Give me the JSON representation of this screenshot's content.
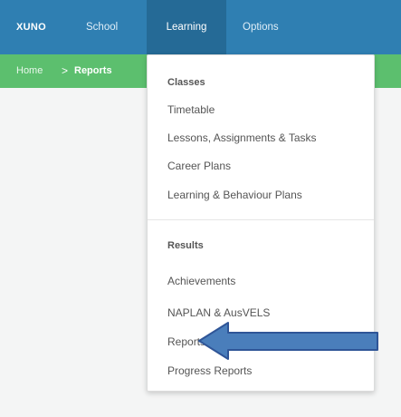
{
  "navbar": {
    "brand": "XUNO",
    "items": [
      {
        "label": "School"
      },
      {
        "label": "Learning"
      },
      {
        "label": "Options"
      }
    ]
  },
  "breadcrumb": {
    "home": "Home",
    "separator": ">",
    "current": "Reports"
  },
  "dropdown": {
    "sections": [
      {
        "header": "Classes",
        "items": [
          {
            "label": "Timetable"
          },
          {
            "label": "Lessons, Assignments & Tasks"
          },
          {
            "label": "Career Plans"
          },
          {
            "label": "Learning & Behaviour Plans"
          }
        ]
      },
      {
        "header": "Results",
        "items": [
          {
            "label": "Achievements"
          },
          {
            "label": "NAPLAN & AusVELS"
          },
          {
            "label": "Reports"
          },
          {
            "label": "Progress Reports"
          }
        ]
      }
    ]
  },
  "colors": {
    "navbar": "#2f7fb2",
    "navbar_active": "#256a96",
    "subbar": "#5cbf6e",
    "arrow_fill": "#4a7ebb",
    "arrow_stroke": "#2f5597"
  }
}
